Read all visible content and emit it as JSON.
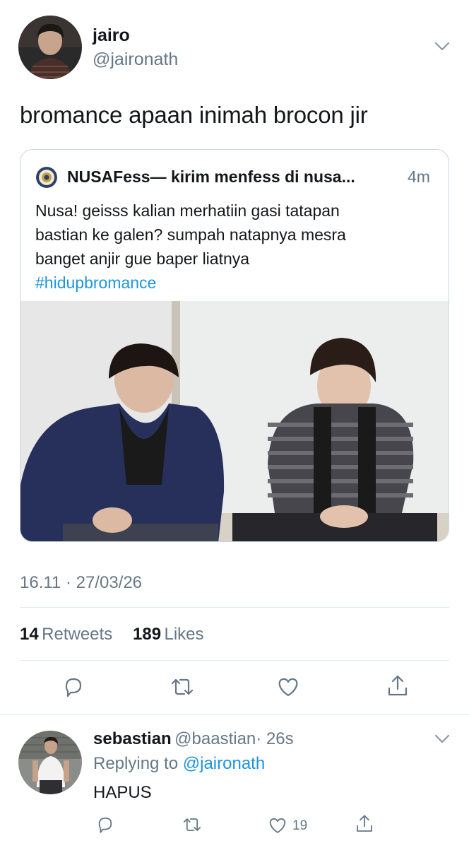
{
  "tweet": {
    "author_name": "jairo",
    "author_handle": "@jaironath",
    "text": "bromance apaan inimah brocon jir",
    "timestamp": "16.11 · 27/03/26",
    "retweets_count": "14",
    "retweets_label": "Retweets",
    "likes_count": "189",
    "likes_label": "Likes"
  },
  "quote": {
    "name": "NUSAFess— kirim menfess di nusa...",
    "time": "4m",
    "text_lines": [
      "Nusa! geisss kalian merhatiin gasi tatapan",
      "bastian ke galen? sumpah natapnya mesra",
      "banget anjir gue baper liatnya"
    ],
    "hashtag": "#hidupbromance"
  },
  "reply": {
    "name": "sebastian",
    "handle": "@baastian",
    "time": "· 26s",
    "replying_prefix": "Replying to",
    "replying_handle": "@jaironath",
    "text": "HAPUS",
    "like_count": "19"
  },
  "colors": {
    "link": "#1b95e0",
    "secondary_text": "#657786",
    "divider": "#e1e8ed"
  },
  "icons": [
    "chevron-down-icon",
    "reply-icon",
    "retweet-icon",
    "like-icon",
    "share-icon"
  ]
}
